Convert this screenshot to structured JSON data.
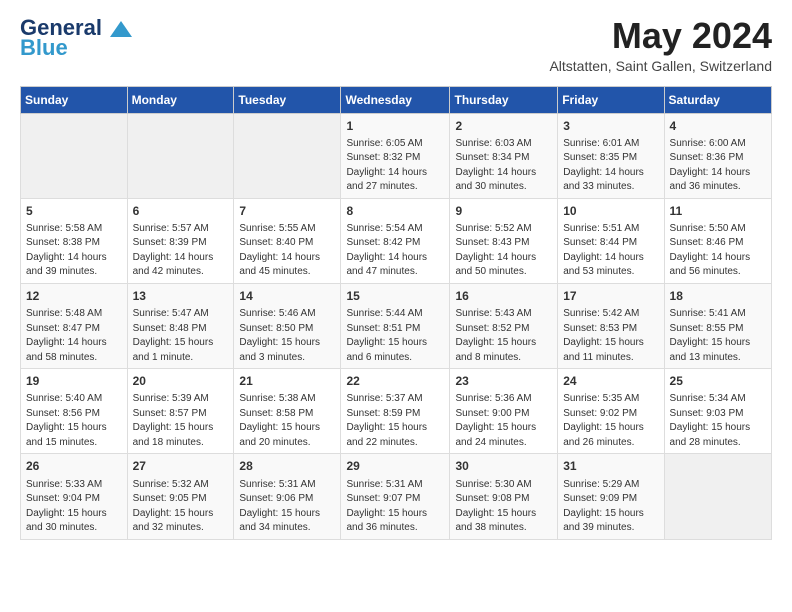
{
  "header": {
    "logo_line1": "General",
    "logo_line2": "Blue",
    "month_title": "May 2024",
    "location": "Altstatten, Saint Gallen, Switzerland"
  },
  "days_of_week": [
    "Sunday",
    "Monday",
    "Tuesday",
    "Wednesday",
    "Thursday",
    "Friday",
    "Saturday"
  ],
  "weeks": [
    [
      {
        "day": "",
        "info": ""
      },
      {
        "day": "",
        "info": ""
      },
      {
        "day": "",
        "info": ""
      },
      {
        "day": "1",
        "info": "Sunrise: 6:05 AM\nSunset: 8:32 PM\nDaylight: 14 hours\nand 27 minutes."
      },
      {
        "day": "2",
        "info": "Sunrise: 6:03 AM\nSunset: 8:34 PM\nDaylight: 14 hours\nand 30 minutes."
      },
      {
        "day": "3",
        "info": "Sunrise: 6:01 AM\nSunset: 8:35 PM\nDaylight: 14 hours\nand 33 minutes."
      },
      {
        "day": "4",
        "info": "Sunrise: 6:00 AM\nSunset: 8:36 PM\nDaylight: 14 hours\nand 36 minutes."
      }
    ],
    [
      {
        "day": "5",
        "info": "Sunrise: 5:58 AM\nSunset: 8:38 PM\nDaylight: 14 hours\nand 39 minutes."
      },
      {
        "day": "6",
        "info": "Sunrise: 5:57 AM\nSunset: 8:39 PM\nDaylight: 14 hours\nand 42 minutes."
      },
      {
        "day": "7",
        "info": "Sunrise: 5:55 AM\nSunset: 8:40 PM\nDaylight: 14 hours\nand 45 minutes."
      },
      {
        "day": "8",
        "info": "Sunrise: 5:54 AM\nSunset: 8:42 PM\nDaylight: 14 hours\nand 47 minutes."
      },
      {
        "day": "9",
        "info": "Sunrise: 5:52 AM\nSunset: 8:43 PM\nDaylight: 14 hours\nand 50 minutes."
      },
      {
        "day": "10",
        "info": "Sunrise: 5:51 AM\nSunset: 8:44 PM\nDaylight: 14 hours\nand 53 minutes."
      },
      {
        "day": "11",
        "info": "Sunrise: 5:50 AM\nSunset: 8:46 PM\nDaylight: 14 hours\nand 56 minutes."
      }
    ],
    [
      {
        "day": "12",
        "info": "Sunrise: 5:48 AM\nSunset: 8:47 PM\nDaylight: 14 hours\nand 58 minutes."
      },
      {
        "day": "13",
        "info": "Sunrise: 5:47 AM\nSunset: 8:48 PM\nDaylight: 15 hours\nand 1 minute."
      },
      {
        "day": "14",
        "info": "Sunrise: 5:46 AM\nSunset: 8:50 PM\nDaylight: 15 hours\nand 3 minutes."
      },
      {
        "day": "15",
        "info": "Sunrise: 5:44 AM\nSunset: 8:51 PM\nDaylight: 15 hours\nand 6 minutes."
      },
      {
        "day": "16",
        "info": "Sunrise: 5:43 AM\nSunset: 8:52 PM\nDaylight: 15 hours\nand 8 minutes."
      },
      {
        "day": "17",
        "info": "Sunrise: 5:42 AM\nSunset: 8:53 PM\nDaylight: 15 hours\nand 11 minutes."
      },
      {
        "day": "18",
        "info": "Sunrise: 5:41 AM\nSunset: 8:55 PM\nDaylight: 15 hours\nand 13 minutes."
      }
    ],
    [
      {
        "day": "19",
        "info": "Sunrise: 5:40 AM\nSunset: 8:56 PM\nDaylight: 15 hours\nand 15 minutes."
      },
      {
        "day": "20",
        "info": "Sunrise: 5:39 AM\nSunset: 8:57 PM\nDaylight: 15 hours\nand 18 minutes."
      },
      {
        "day": "21",
        "info": "Sunrise: 5:38 AM\nSunset: 8:58 PM\nDaylight: 15 hours\nand 20 minutes."
      },
      {
        "day": "22",
        "info": "Sunrise: 5:37 AM\nSunset: 8:59 PM\nDaylight: 15 hours\nand 22 minutes."
      },
      {
        "day": "23",
        "info": "Sunrise: 5:36 AM\nSunset: 9:00 PM\nDaylight: 15 hours\nand 24 minutes."
      },
      {
        "day": "24",
        "info": "Sunrise: 5:35 AM\nSunset: 9:02 PM\nDaylight: 15 hours\nand 26 minutes."
      },
      {
        "day": "25",
        "info": "Sunrise: 5:34 AM\nSunset: 9:03 PM\nDaylight: 15 hours\nand 28 minutes."
      }
    ],
    [
      {
        "day": "26",
        "info": "Sunrise: 5:33 AM\nSunset: 9:04 PM\nDaylight: 15 hours\nand 30 minutes."
      },
      {
        "day": "27",
        "info": "Sunrise: 5:32 AM\nSunset: 9:05 PM\nDaylight: 15 hours\nand 32 minutes."
      },
      {
        "day": "28",
        "info": "Sunrise: 5:31 AM\nSunset: 9:06 PM\nDaylight: 15 hours\nand 34 minutes."
      },
      {
        "day": "29",
        "info": "Sunrise: 5:31 AM\nSunset: 9:07 PM\nDaylight: 15 hours\nand 36 minutes."
      },
      {
        "day": "30",
        "info": "Sunrise: 5:30 AM\nSunset: 9:08 PM\nDaylight: 15 hours\nand 38 minutes."
      },
      {
        "day": "31",
        "info": "Sunrise: 5:29 AM\nSunset: 9:09 PM\nDaylight: 15 hours\nand 39 minutes."
      },
      {
        "day": "",
        "info": ""
      }
    ]
  ]
}
